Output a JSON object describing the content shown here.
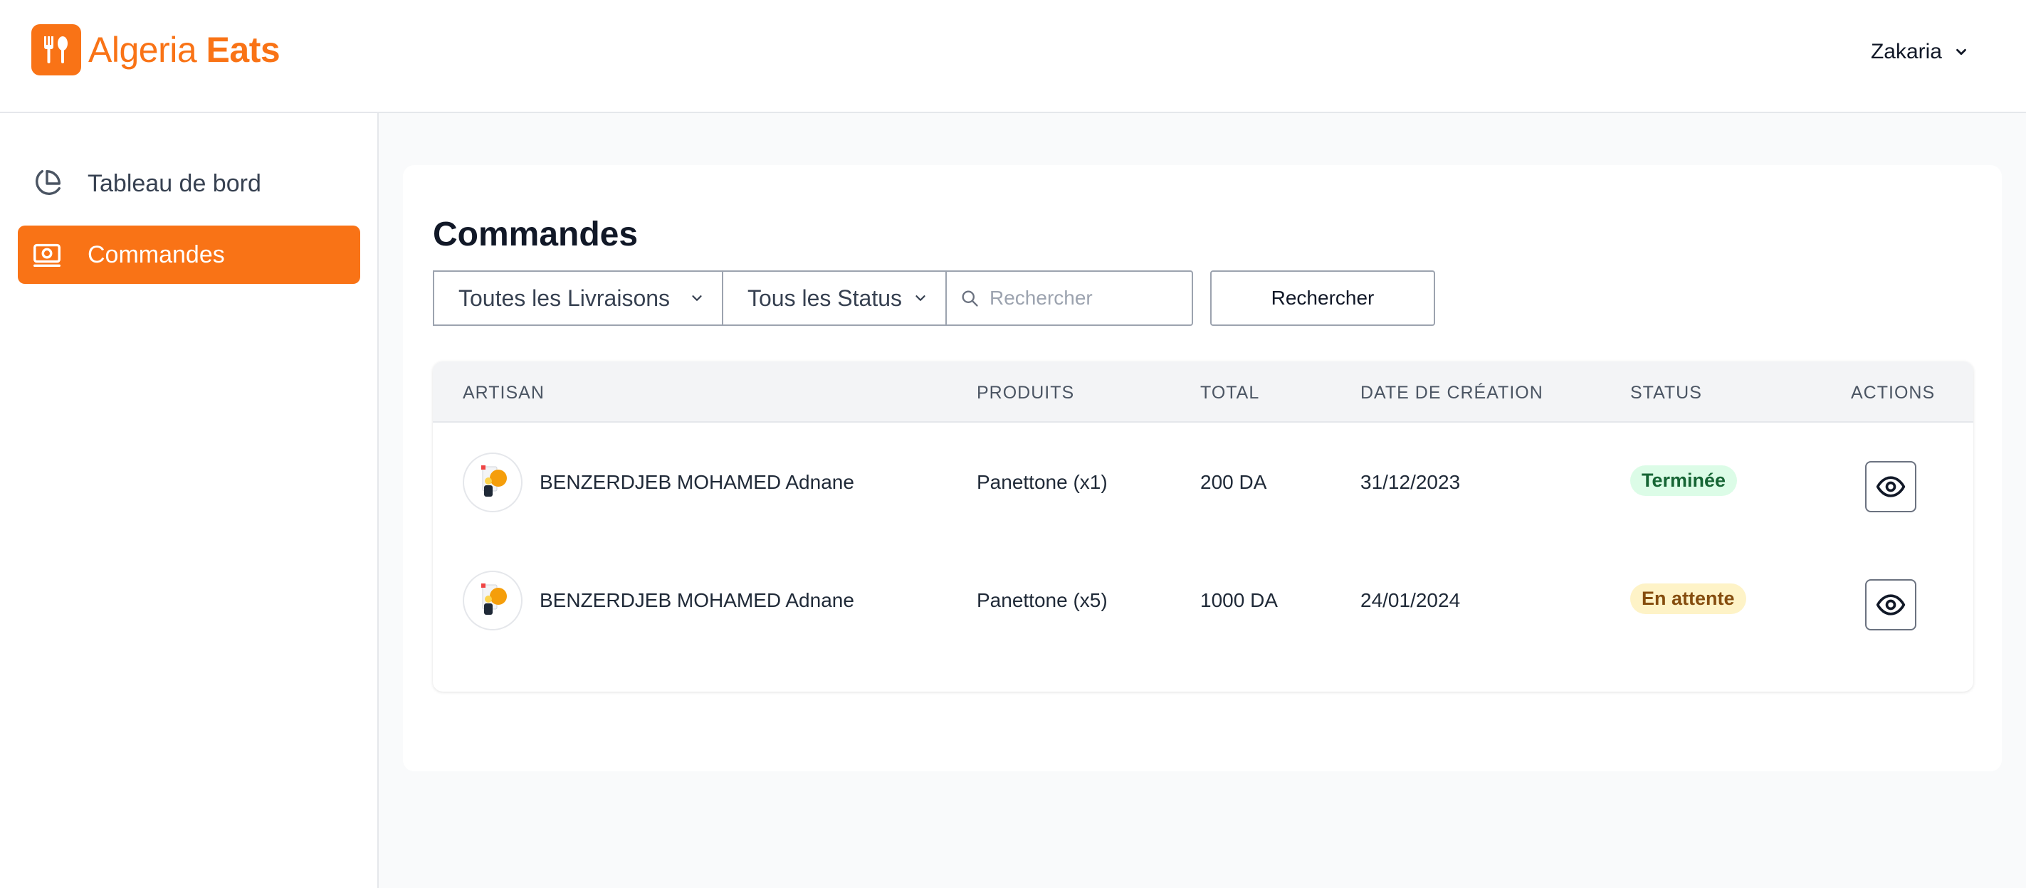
{
  "brand": {
    "name_part1": "Algeria",
    "name_part2": "Eats",
    "color": "#f97316"
  },
  "header": {
    "user_name": "Zakaria"
  },
  "sidebar": {
    "items": [
      {
        "label": "Tableau de bord",
        "icon": "pie-chart-icon",
        "active": false
      },
      {
        "label": "Commandes",
        "icon": "money-icon",
        "active": true
      }
    ]
  },
  "main": {
    "title": "Commandes",
    "filters": {
      "delivery_select": "Toutes les Livraisons",
      "status_select": "Tous les Status",
      "search_placeholder": "Rechercher",
      "search_button": "Rechercher"
    },
    "table": {
      "columns": [
        "ARTISAN",
        "PRODUITS",
        "TOTAL",
        "DATE DE CRÉATION",
        "STATUS",
        "ACTIONS"
      ],
      "rows": [
        {
          "artisan": "BENZERDJEB MOHAMED Adnane",
          "produits": "Panettone (x1)",
          "total": "200 DA",
          "date": "31/12/2023",
          "status": "Terminée",
          "status_type": "done",
          "action_icon": "eye-icon"
        },
        {
          "artisan": "BENZERDJEB MOHAMED Adnane",
          "produits": "Panettone (x5)",
          "total": "1000 DA",
          "date": "24/01/2024",
          "status": "En attente",
          "status_type": "pending",
          "action_icon": "eye-icon"
        }
      ]
    }
  },
  "colors": {
    "accent": "#f97316",
    "done_bg": "#dcfce7",
    "pending_bg": "#fef3c7"
  }
}
